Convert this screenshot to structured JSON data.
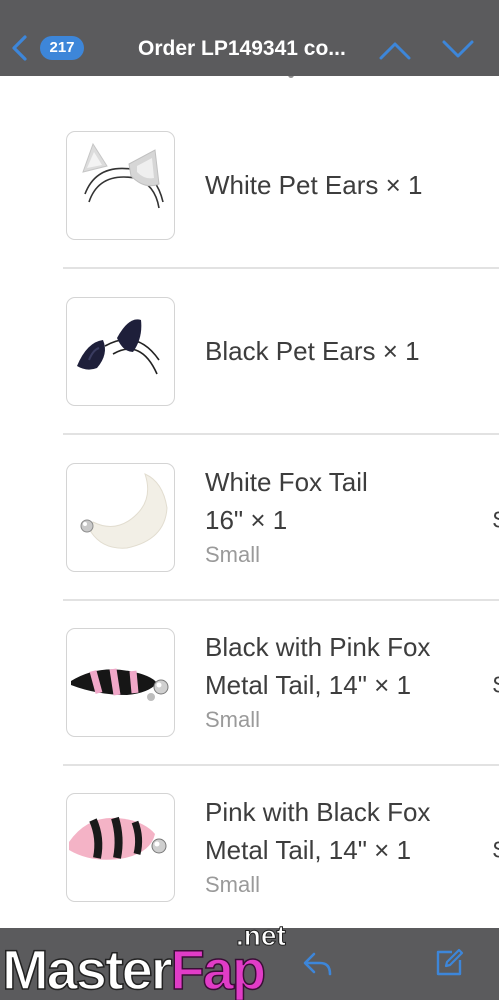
{
  "header": {
    "back_icon": "chevron-left-icon",
    "message_count": "217",
    "title": "Order LP149341 co...",
    "prev_icon": "chevron-up-icon",
    "next_icon": "chevron-down-icon",
    "accent": "#3d86d9",
    "bar_color": "#5b5b5d"
  },
  "items": [
    {
      "name": "White Pet Ears × 1",
      "variant": "",
      "price": "",
      "thumb_icon": "white-cat-ears-icon"
    },
    {
      "name": "Black Pet Ears × 1",
      "variant": "",
      "price": "",
      "thumb_icon": "black-cat-ears-icon"
    },
    {
      "name": "White Fox Tail 16\" × 1",
      "name_line1": "White Fox Tail",
      "name_line2": "16\" × 1",
      "variant": "Small",
      "price": "$",
      "thumb_icon": "white-tail-icon"
    },
    {
      "name": "Black with Pink Fox Metal Tail, 14\" × 1",
      "name_line1": "Black with Pink Fox",
      "name_line2": "Metal Tail, 14\" × 1",
      "variant": "Small",
      "price": "$",
      "thumb_icon": "black-pink-tail-icon"
    },
    {
      "name": "Pink with Black Fox Metal Tail, 14\" × 1",
      "name_line1": "Pink with Black Fox",
      "name_line2": "Metal Tail, 14\" × 1",
      "variant": "Small",
      "price": "$",
      "thumb_icon": "pink-black-tail-icon"
    }
  ],
  "toolbar": {
    "reply_icon": "reply-icon",
    "compose_icon": "compose-icon"
  },
  "watermark": {
    "part1": "Master",
    "part2": "Fap",
    "suffix": ".net"
  }
}
